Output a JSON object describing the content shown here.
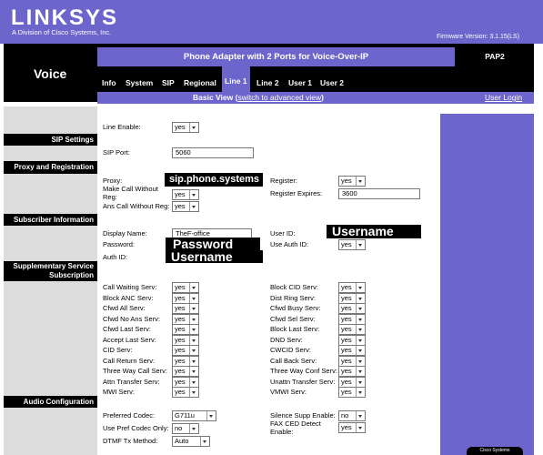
{
  "header": {
    "logo": "LINKSYS",
    "logo_sub": "A Division of Cisco Systems, Inc.",
    "firmware": "Firmware Version: 3.1.15(LS)",
    "section_title": "Voice",
    "product": "Phone Adapter with 2 Ports for Voice-Over-IP",
    "model": "PAP2"
  },
  "tabs": [
    "Info",
    "System",
    "SIP",
    "Regional",
    "Line 1",
    "Line 2",
    "User 1",
    "User 2"
  ],
  "active_tab": "Line 1",
  "viewbar": {
    "basic_view": "Basic View",
    "switch_open": "(",
    "switch_link": "switch to advanced view",
    "switch_close": ")",
    "user_login": "User Login"
  },
  "sections": {
    "sip_settings": "SIP Settings",
    "proxy": "Proxy and Registration",
    "subscriber": "Subscriber Information",
    "supplementary_1": "Supplementary Service",
    "supplementary_2": "Subscription",
    "audio": "Audio Configuration"
  },
  "line_enable": {
    "label": "Line Enable:",
    "value": "yes"
  },
  "sip_port": {
    "label": "SIP Port:",
    "value": "5060"
  },
  "proxy": {
    "proxy_label": "Proxy:",
    "proxy_value": "sip.phone.systems",
    "make_call_label_1": "Make Call Without",
    "make_call_label_2": "Reg:",
    "make_call_value": "yes",
    "ans_call_label": "Ans Call Without Reg:",
    "ans_call_value": "yes",
    "register_label": "Register:",
    "register_value": "yes",
    "register_expires_label": "Register Expires:",
    "register_expires_value": "3600"
  },
  "subscriber": {
    "display_name_label": "Display Name:",
    "display_name_value": "TheF-office",
    "password_label": "Password:",
    "password_value": "Password",
    "auth_id_label": "Auth ID:",
    "auth_id_value": "Username",
    "user_id_label": "User ID:",
    "user_id_value": "Username",
    "use_auth_id_label": "Use Auth ID:",
    "use_auth_id_value": "yes"
  },
  "supplementary_left": [
    {
      "label": "Call Waiting Serv:",
      "value": "yes"
    },
    {
      "label": "Block ANC Serv:",
      "value": "yes"
    },
    {
      "label": "Cfwd All Serv:",
      "value": "yes"
    },
    {
      "label": "Cfwd No Ans Serv:",
      "value": "yes"
    },
    {
      "label": "Cfwd Last Serv:",
      "value": "yes"
    },
    {
      "label": "Accept Last Serv:",
      "value": "yes"
    },
    {
      "label": "CID Serv:",
      "value": "yes"
    },
    {
      "label": "Call Return Serv:",
      "value": "yes"
    },
    {
      "label": "Three Way Call Serv:",
      "value": "yes"
    },
    {
      "label": "Attn Transfer Serv:",
      "value": "yes"
    },
    {
      "label": "MWI Serv:",
      "value": "yes"
    }
  ],
  "supplementary_right": [
    {
      "label": "Block CID Serv:",
      "value": "yes"
    },
    {
      "label": "Dist Ring Serv:",
      "value": "yes"
    },
    {
      "label": "Cfwd Busy Serv:",
      "value": "yes"
    },
    {
      "label": "Cfwd Sel Serv:",
      "value": "yes"
    },
    {
      "label": "Block Last Serv:",
      "value": "yes"
    },
    {
      "label": "DND Serv:",
      "value": "yes"
    },
    {
      "label": "CWCID Serv:",
      "value": "yes"
    },
    {
      "label": "Call Back Serv:",
      "value": "yes"
    },
    {
      "label": "Three Way Conf Serv:",
      "value": "yes"
    },
    {
      "label": "Unattn Transfer Serv:",
      "value": "yes"
    },
    {
      "label": "VMWI Serv:",
      "value": "yes"
    }
  ],
  "audio": {
    "preferred_codec_label": "Preferred Codec:",
    "preferred_codec_value": "G711u",
    "use_pref_label": "Use Pref Codec Only:",
    "use_pref_value": "no",
    "dtmf_label": "DTMF Tx Method:",
    "dtmf_value": "Auto",
    "silence_label": "Silence Supp Enable:",
    "silence_value": "no",
    "fax_label_1": "FAX CED Detect",
    "fax_label_2": "Enable:",
    "fax_value": "yes"
  },
  "footer_tag": "Cisco Systems",
  "colors": {
    "brand_purple": "#6b65cc",
    "black": "#000000",
    "left_gray": "#dcdcdc"
  }
}
